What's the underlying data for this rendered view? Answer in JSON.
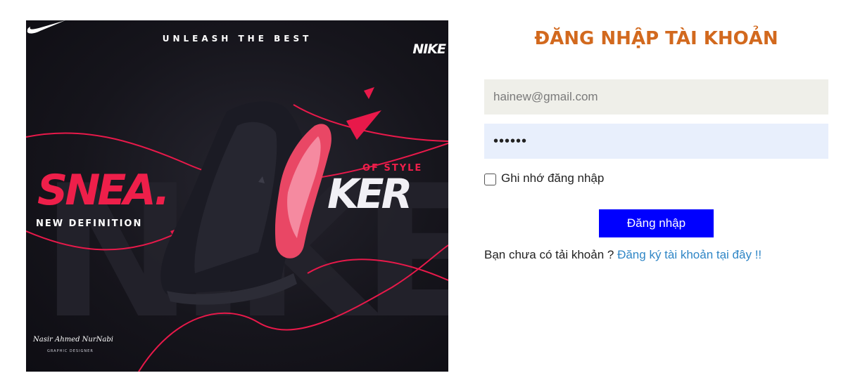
{
  "banner": {
    "tagline": "UNLEASH THE BEST",
    "brand": "NIKE",
    "headline_left": "SNEA.",
    "headline_right": "KER",
    "accent_text": "OF STYLE",
    "subtitle": "NEW DEFINITION",
    "signature_name": "Nasir Ahmed NurNabi",
    "signature_role": "GRAPHIC DESIGNER",
    "accent_color": "#ee1f4a",
    "background_color": "#16151c"
  },
  "login": {
    "title": "ĐĂNG NHẬP TÀI KHOẢN",
    "email_value": "hainew@gmail.com",
    "password_value": "••••••",
    "remember_label": "Ghi nhớ đăng nhập",
    "submit_label": "Đăng nhập",
    "register_prompt": "Bạn chưa có tải khoản ?",
    "register_link": "Đăng ký tài khoản tại đây !!",
    "title_color": "#d2691e",
    "button_color": "#0000ff",
    "link_color": "#2f86c6"
  }
}
